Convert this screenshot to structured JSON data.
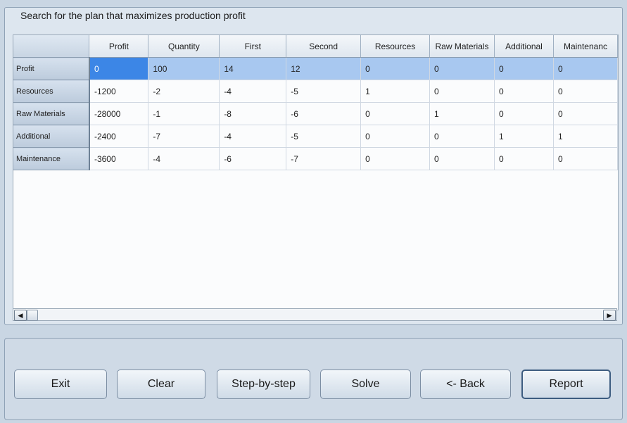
{
  "group_title": "Search for the plan that maximizes production profit",
  "table": {
    "columns": [
      "Profit",
      "Quantity",
      "First",
      "Second",
      "Resources",
      "Raw Materials",
      "Additional",
      "Maintenanc"
    ],
    "rows": [
      {
        "header": "Profit",
        "cells": [
          "0",
          "100",
          "14",
          "12",
          "0",
          "0",
          "0",
          "0"
        ]
      },
      {
        "header": "Resources",
        "cells": [
          "-1200",
          "-2",
          "-4",
          "-5",
          "1",
          "0",
          "0",
          "0"
        ]
      },
      {
        "header": "Raw Materials",
        "cells": [
          "-28000",
          "-1",
          "-8",
          "-6",
          "0",
          "1",
          "0",
          "0"
        ]
      },
      {
        "header": "Additional",
        "cells": [
          "-2400",
          "-7",
          "-4",
          "-5",
          "0",
          "0",
          "1",
          "1"
        ]
      },
      {
        "header": "Maintenance",
        "cells": [
          "-3600",
          "-4",
          "-6",
          "-7",
          "0",
          "0",
          "0",
          "0"
        ]
      }
    ],
    "selected_row": "Profit",
    "active_cell": "Profit / Profit"
  },
  "scrollbar": {
    "left_icon": "arrow-left-icon",
    "right_icon": "arrow-right-icon",
    "left_glyph": "◀",
    "right_glyph": "▶"
  },
  "buttons": {
    "exit": "Exit",
    "clear": "Clear",
    "step": "Step-by-step",
    "solve": "Solve",
    "back": "<- Back",
    "report": "Report"
  },
  "colors": {
    "selection": "#a8c8f0",
    "active_cell": "#3c86e6",
    "background": "#c9d6e3"
  }
}
